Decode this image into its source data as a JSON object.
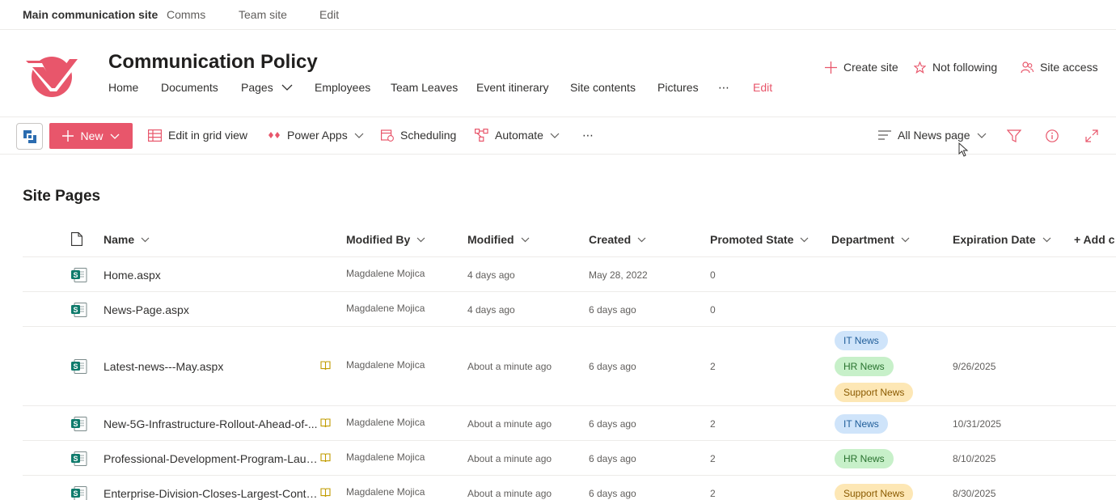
{
  "hub": {
    "title": "Main communication site",
    "links": [
      "Comms",
      "Team site",
      "Edit"
    ]
  },
  "site": {
    "title": "Communication Policy",
    "nav": [
      "Home",
      "Documents",
      "Pages",
      "Employees",
      "Team Leaves",
      "Event itinerary",
      "Site contents",
      "Pictures",
      "⋯",
      "Edit"
    ],
    "actions": [
      "Create site",
      "Not following",
      "Site access"
    ]
  },
  "command": {
    "new": "New",
    "edit_grid": "Edit in grid view",
    "power_apps": "Power Apps",
    "scheduling": "Scheduling",
    "automate": "Automate",
    "more": "⋯",
    "view": "All News page"
  },
  "list": {
    "title": "Site Pages",
    "columns": [
      "Name",
      "Modified By",
      "Modified",
      "Created",
      "Promoted State",
      "Department",
      "Expiration Date",
      "+ Add c"
    ],
    "rows": [
      {
        "name": "Home.aspx",
        "modified_by": "Magdalene Mojica",
        "modified": "4 days ago",
        "created": "May 28, 2022",
        "promoted": "0",
        "departments": [],
        "expiration": "",
        "book": false
      },
      {
        "name": "News-Page.aspx",
        "modified_by": "Magdalene Mojica",
        "modified": "4 days ago",
        "created": "6 days ago",
        "promoted": "0",
        "departments": [],
        "expiration": "",
        "book": false
      },
      {
        "name": "Latest-news---May.aspx",
        "modified_by": "Magdalene Mojica",
        "modified": "About a minute ago",
        "created": "6 days ago",
        "promoted": "2",
        "departments": [
          "IT News",
          "HR News",
          "Support News"
        ],
        "expiration": "9/26/2025",
        "book": true
      },
      {
        "name": "New-5G-Infrastructure-Rollout-Ahead-of-...",
        "modified_by": "Magdalene Mojica",
        "modified": "About a minute ago",
        "created": "6 days ago",
        "promoted": "2",
        "departments": [
          "IT News"
        ],
        "expiration": "10/31/2025",
        "book": true
      },
      {
        "name": "Professional-Development-Program-Laun...",
        "modified_by": "Magdalene Mojica",
        "modified": "About a minute ago",
        "created": "6 days ago",
        "promoted": "2",
        "departments": [
          "HR News"
        ],
        "expiration": "8/10/2025",
        "book": true
      },
      {
        "name": "Enterprise-Division-Closes-Largest-Contra...",
        "modified_by": "Magdalene Mojica",
        "modified": "About a minute ago",
        "created": "6 days ago",
        "promoted": "2",
        "departments": [
          "Support News"
        ],
        "expiration": "8/30/2025",
        "book": true
      }
    ]
  },
  "colors": {
    "accent": "#e8566b",
    "it_news_bg": "#cfe4fa",
    "hr_news_bg": "#c7f0c9",
    "support_news_bg": "#fde7b5"
  }
}
